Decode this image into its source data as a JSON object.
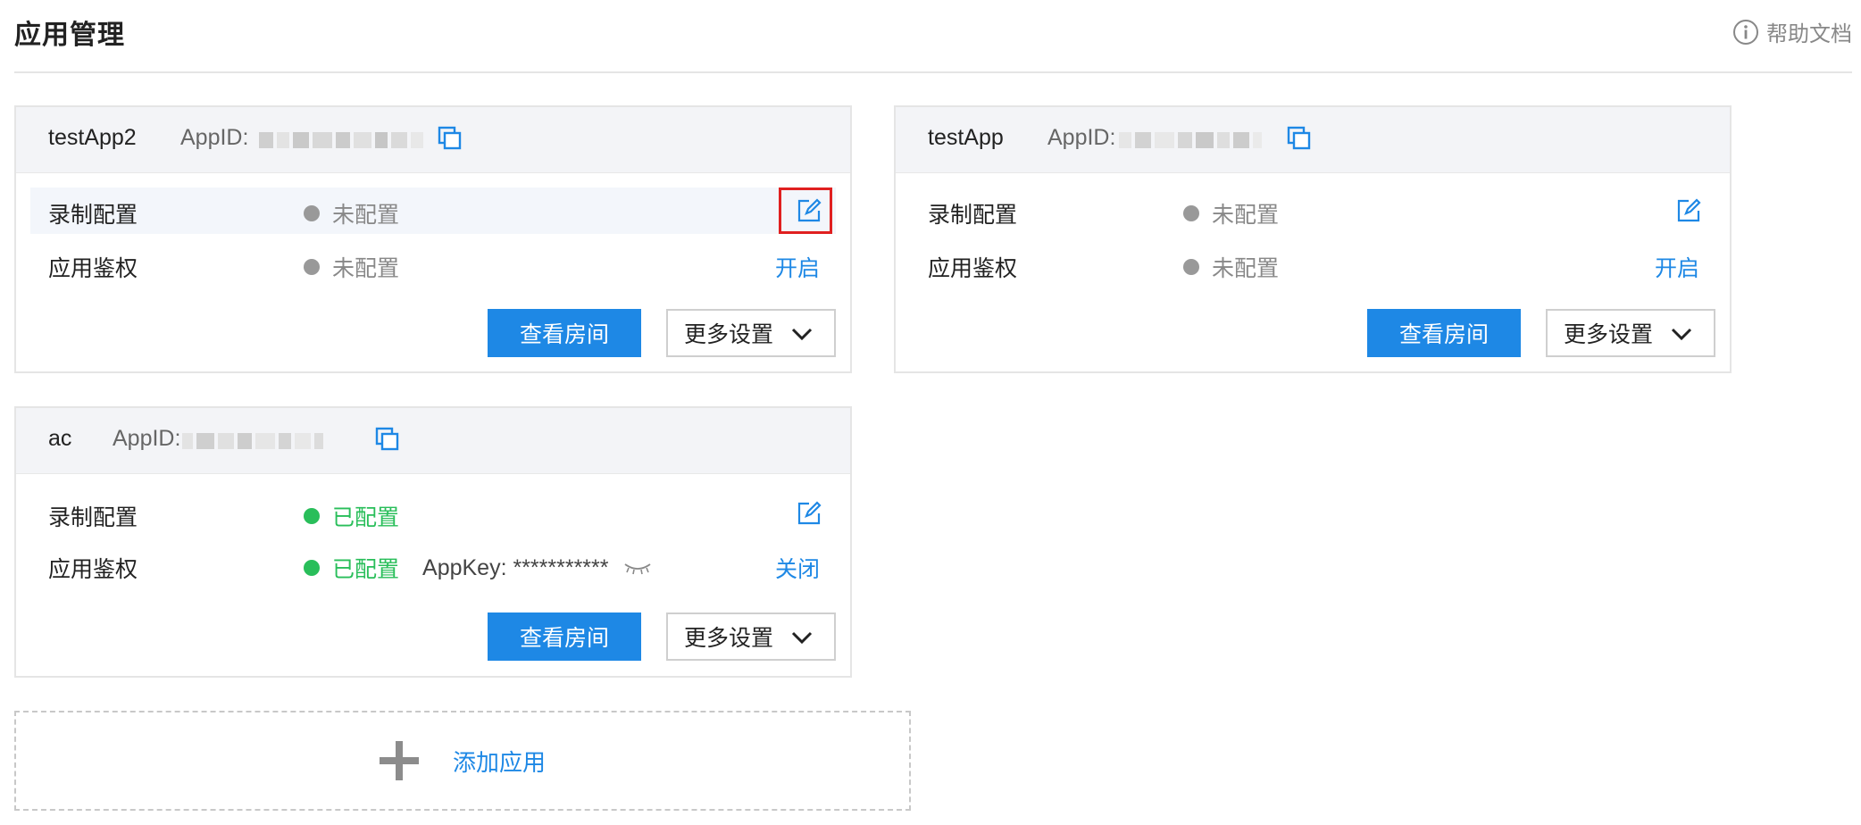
{
  "header": {
    "title": "应用管理",
    "help_label": "帮助文档"
  },
  "apps": [
    {
      "name": "testApp2",
      "appid_label": "AppID:",
      "rows": [
        {
          "label": "录制配置",
          "status": "未配置"
        },
        {
          "label": "应用鉴权",
          "status": "未配置",
          "action": "开启"
        }
      ],
      "view_rooms": "查看房间",
      "more_settings": "更多设置"
    },
    {
      "name": "testApp",
      "appid_label": "AppID:",
      "rows": [
        {
          "label": "录制配置",
          "status": "未配置"
        },
        {
          "label": "应用鉴权",
          "status": "未配置",
          "action": "开启"
        }
      ],
      "view_rooms": "查看房间",
      "more_settings": "更多设置"
    },
    {
      "name": "ac",
      "appid_label": "AppID:",
      "rows": [
        {
          "label": "录制配置",
          "status": "已配置"
        },
        {
          "label": "应用鉴权",
          "status": "已配置",
          "appkey_label": "AppKey: ***********",
          "action": "关闭"
        }
      ],
      "view_rooms": "查看房间",
      "more_settings": "更多设置"
    }
  ],
  "add_app": {
    "label": "添加应用"
  },
  "colors": {
    "primary": "#1e88e5",
    "success": "#29be5a",
    "muted": "#999999",
    "highlight": "#e02020"
  }
}
